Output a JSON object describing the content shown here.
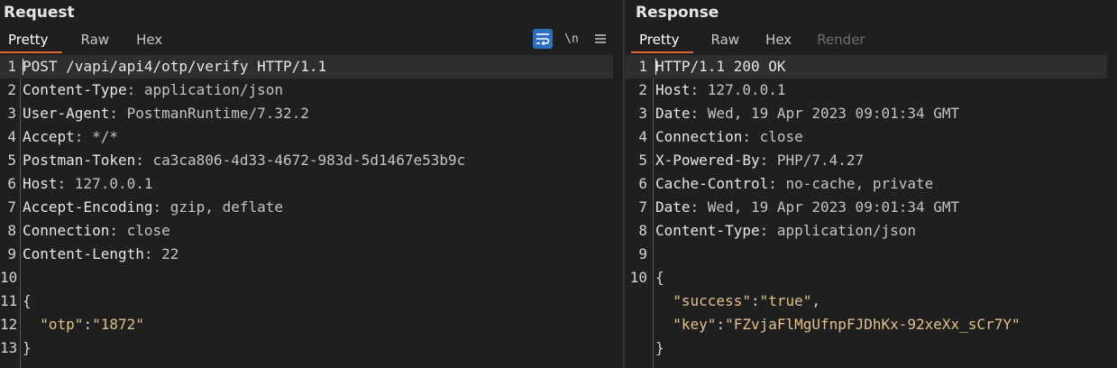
{
  "request": {
    "title": "Request",
    "tabs": [
      "Pretty",
      "Raw",
      "Hex"
    ],
    "toolbar": [
      {
        "icon": "wrap-lines-icon",
        "label": ""
      },
      {
        "icon": "newline-toggle-icon",
        "label": "\\n"
      },
      {
        "icon": "menu-icon",
        "label": "≡"
      }
    ],
    "lines": [
      {
        "n": "1",
        "parts": [
          {
            "t": "POST /vapi/api4/otp/verify HTTP/1.1",
            "c": "k"
          }
        ]
      },
      {
        "n": "2",
        "parts": [
          {
            "t": "Content-Type",
            "c": "k"
          },
          {
            "t": ": application/json",
            "c": "v"
          }
        ]
      },
      {
        "n": "3",
        "parts": [
          {
            "t": "User-Agent",
            "c": "k"
          },
          {
            "t": ": PostmanRuntime/7.32.2",
            "c": "v"
          }
        ]
      },
      {
        "n": "4",
        "parts": [
          {
            "t": "Accept",
            "c": "k"
          },
          {
            "t": ": */*",
            "c": "v"
          }
        ]
      },
      {
        "n": "5",
        "parts": [
          {
            "t": "Postman-Token",
            "c": "k"
          },
          {
            "t": ": ca3ca806-4d33-4672-983d-5d1467e53b9c",
            "c": "v"
          }
        ]
      },
      {
        "n": "6",
        "parts": [
          {
            "t": "Host",
            "c": "k"
          },
          {
            "t": ": 127.0.0.1",
            "c": "v"
          }
        ]
      },
      {
        "n": "7",
        "parts": [
          {
            "t": "Accept-Encoding",
            "c": "k"
          },
          {
            "t": ": gzip, deflate",
            "c": "v"
          }
        ]
      },
      {
        "n": "8",
        "parts": [
          {
            "t": "Connection",
            "c": "k"
          },
          {
            "t": ": close",
            "c": "v"
          }
        ]
      },
      {
        "n": "9",
        "parts": [
          {
            "t": "Content-Length",
            "c": "k"
          },
          {
            "t": ": 22",
            "c": "v"
          }
        ]
      },
      {
        "n": "10",
        "parts": []
      },
      {
        "n": "11",
        "parts": [
          {
            "t": "{",
            "c": "p"
          }
        ]
      },
      {
        "n": "12",
        "parts": [
          {
            "t": "  ",
            "c": "p"
          },
          {
            "t": "\"otp\"",
            "c": "js"
          },
          {
            "t": ":",
            "c": "p"
          },
          {
            "t": "\"1872\"",
            "c": "js"
          }
        ]
      },
      {
        "n": "13",
        "parts": [
          {
            "t": "}",
            "c": "p"
          }
        ]
      }
    ]
  },
  "response": {
    "title": "Response",
    "tabs": [
      "Pretty",
      "Raw",
      "Hex",
      "Render"
    ],
    "lines": [
      {
        "n": "1",
        "parts": [
          {
            "t": "HTTP/1.1 200 OK",
            "c": "k"
          }
        ]
      },
      {
        "n": "2",
        "parts": [
          {
            "t": "Host",
            "c": "k"
          },
          {
            "t": ": 127.0.0.1",
            "c": "v"
          }
        ]
      },
      {
        "n": "3",
        "parts": [
          {
            "t": "Date",
            "c": "k"
          },
          {
            "t": ": Wed, 19 Apr 2023 09:01:34 GMT",
            "c": "v"
          }
        ]
      },
      {
        "n": "4",
        "parts": [
          {
            "t": "Connection",
            "c": "k"
          },
          {
            "t": ": close",
            "c": "v"
          }
        ]
      },
      {
        "n": "5",
        "parts": [
          {
            "t": "X-Powered-By",
            "c": "k"
          },
          {
            "t": ": PHP/7.4.27",
            "c": "v"
          }
        ]
      },
      {
        "n": "6",
        "parts": [
          {
            "t": "Cache-Control",
            "c": "k"
          },
          {
            "t": ": no-cache, private",
            "c": "v"
          }
        ]
      },
      {
        "n": "7",
        "parts": [
          {
            "t": "Date",
            "c": "k"
          },
          {
            "t": ": Wed, 19 Apr 2023 09:01:34 GMT",
            "c": "v"
          }
        ]
      },
      {
        "n": "8",
        "parts": [
          {
            "t": "Content-Type",
            "c": "k"
          },
          {
            "t": ": application/json",
            "c": "v"
          }
        ]
      },
      {
        "n": "9",
        "parts": []
      },
      {
        "n": "10",
        "parts": [
          {
            "t": "{",
            "c": "p"
          }
        ]
      },
      {
        "n": "",
        "parts": [
          {
            "t": "  ",
            "c": "p"
          },
          {
            "t": "\"success\"",
            "c": "js"
          },
          {
            "t": ":",
            "c": "p"
          },
          {
            "t": "\"true\"",
            "c": "js"
          },
          {
            "t": ",",
            "c": "p"
          }
        ]
      },
      {
        "n": "",
        "parts": [
          {
            "t": "  ",
            "c": "p"
          },
          {
            "t": "\"key\"",
            "c": "js"
          },
          {
            "t": ":",
            "c": "p"
          },
          {
            "t": "\"FZvjaFlMgUfnpFJDhKx-92xeXx_sCr7Y\"",
            "c": "js"
          }
        ]
      },
      {
        "n": "",
        "parts": [
          {
            "t": "}",
            "c": "p"
          }
        ]
      }
    ]
  },
  "colors": {
    "background": "#1f1f1f",
    "active_tab_underline": "#e0662f",
    "toolbar_active": "#2f6fbf",
    "json_string": "#e2c08d"
  }
}
